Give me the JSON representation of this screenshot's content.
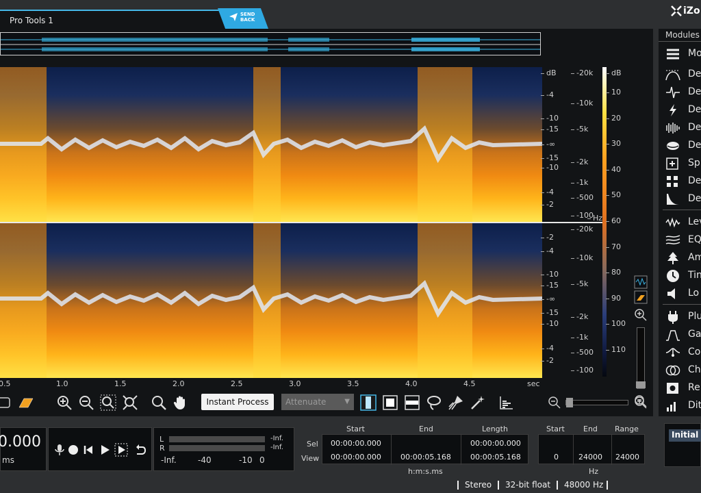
{
  "tab": {
    "title": "Pro Tools 1",
    "send_back": "SEND\nBACK"
  },
  "brand": {
    "logo_text": "iZo"
  },
  "db_scale": {
    "unit": "dB",
    "left_ticks": [
      "-4",
      "-10",
      "-15",
      "-∞",
      "-15",
      "-10",
      "-4",
      "-2"
    ],
    "right_ticks": [
      "-2",
      "-4",
      "-10",
      "-15",
      "-∞",
      "-15",
      "-10",
      "-4",
      "-2"
    ]
  },
  "hz_scale": {
    "unit": "Hz",
    "ticks_top": [
      "-20k",
      "-10k",
      "-5k",
      "-2k",
      "-1k",
      "-500",
      "-100"
    ],
    "ticks_bottom": [
      "-20k",
      "-10k",
      "-5k",
      "-2k",
      "-1k",
      "-500",
      "-100"
    ]
  },
  "colorbar": {
    "unit": "dB",
    "ticks": [
      "10",
      "20",
      "30",
      "40",
      "50",
      "60",
      "70",
      "80",
      "90",
      "100",
      "110"
    ]
  },
  "ruler": {
    "ticks": [
      "0.5",
      "1.0",
      "1.5",
      "2.0",
      "2.5",
      "3.0",
      "3.5",
      "4.0",
      "4.5"
    ],
    "unit": "sec"
  },
  "toolbar": {
    "instant_process": "Instant Process",
    "attenuate": "Attenuate"
  },
  "modules": {
    "title": "Modules",
    "items": [
      {
        "label": "Mo"
      },
      {
        "label": "De"
      },
      {
        "label": "De"
      },
      {
        "label": "De"
      },
      {
        "label": "De"
      },
      {
        "label": "De"
      },
      {
        "label": "Sp"
      },
      {
        "label": "De"
      },
      {
        "label": "De"
      },
      {
        "label": "Lev"
      },
      {
        "label": "EQ"
      },
      {
        "label": "Am"
      },
      {
        "label": "Tin"
      },
      {
        "label": "Lo"
      },
      {
        "label": "Plu"
      },
      {
        "label": "Ga"
      },
      {
        "label": "Co"
      },
      {
        "label": "Ch"
      },
      {
        "label": "Re"
      },
      {
        "label": "Dit"
      }
    ]
  },
  "transport": {
    "timecode": "0.000",
    "timecode_unit": "ms"
  },
  "meter": {
    "l": "L",
    "r": "R",
    "l_val": "-Inf.",
    "r_val": "-Inf.",
    "scale": [
      "-Inf.",
      "-40",
      "-10",
      "0"
    ]
  },
  "selection": {
    "headers": {
      "start": "Start",
      "end": "End",
      "length": "Length"
    },
    "row_labels": {
      "sel": "Sel",
      "view": "View"
    },
    "sel": {
      "start": "00:00:00.000",
      "end": "",
      "length": "00:00:00.000"
    },
    "view": {
      "start": "00:00:00.000",
      "end": "00:00:05.168",
      "length": "00:00:05.168"
    },
    "format": "h:m:s.ms"
  },
  "frequency": {
    "headers": {
      "start": "Start",
      "end": "End",
      "range": "Range"
    },
    "start": "0",
    "end": "24000",
    "range": "24000",
    "unit": "Hz"
  },
  "presets": {
    "selected": "Initial S"
  },
  "status": {
    "channels": "Stereo",
    "bitdepth": "32-bit float",
    "samplerate": "48000 Hz"
  }
}
